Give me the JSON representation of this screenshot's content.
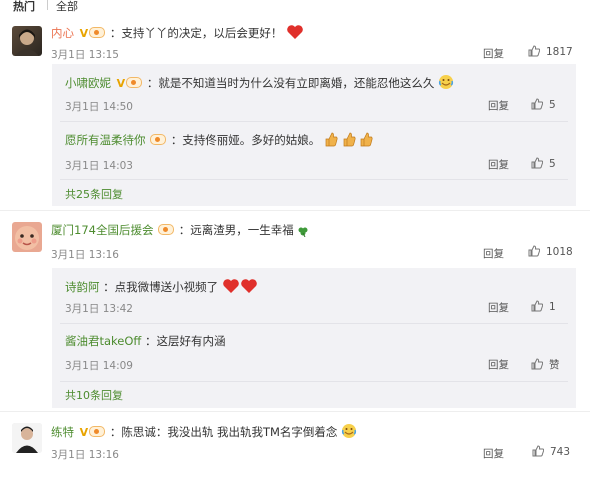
{
  "tabs": {
    "active": "热门",
    "other": "全部"
  },
  "comments": [
    {
      "user": "内心",
      "text": "：支持丫丫的决定，以后会更好！",
      "date": "3月1日",
      "time": "13:15",
      "reply_label": "回复",
      "likes": "1817",
      "replies": [
        {
          "user": "小啸欧妮",
          "text": "：就是不知道当时为什么没有立即离婚，还能忍他这么久",
          "date": "3月1日",
          "time": "14:50",
          "reply_label": "回复",
          "likes": "5"
        },
        {
          "user": "愿所有温柔待你",
          "text": "：支持佟丽娅。多好的姑娘。",
          "date": "3月1日",
          "time": "14:03",
          "reply_label": "回复",
          "likes": "5"
        }
      ],
      "more": "共25条回复"
    },
    {
      "user": "厦门174全国后援会",
      "text": "：远离渣男，一生幸福",
      "date": "3月1日",
      "time": "13:16",
      "reply_label": "回复",
      "likes": "1018",
      "replies": [
        {
          "user": "诗韵阿",
          "text": "：点我微博送小视频了",
          "date": "3月1日",
          "time": "13:42",
          "reply_label": "回复",
          "likes": "1"
        },
        {
          "user": "酱油君takeOff",
          "text": "：这层好有内涵",
          "date": "3月1日",
          "time": "14:09",
          "reply_label": "回复",
          "likes": "赞"
        }
      ],
      "more": "共10条回复"
    },
    {
      "user": "练特",
      "text": "：陈思诚：我没出轨 我出轨我TM名字倒着念",
      "date": "3月1日",
      "time": "13:16",
      "reply_label": "回复",
      "likes": "743"
    }
  ],
  "icons": {
    "like": "thumbs-up-icon",
    "heart": "red-heart-emoji",
    "thumb_emoji": "thumbs-up-emoji",
    "cry_laugh": "tears-of-joy-emoji",
    "clover": "clover-emoji",
    "vip": "vip-badge-icon",
    "verified": "v-badge-icon"
  },
  "colors": {
    "username": "#eb7350",
    "reply_username": "#4d8c2f",
    "reply_bg": "#f2f2f5"
  }
}
